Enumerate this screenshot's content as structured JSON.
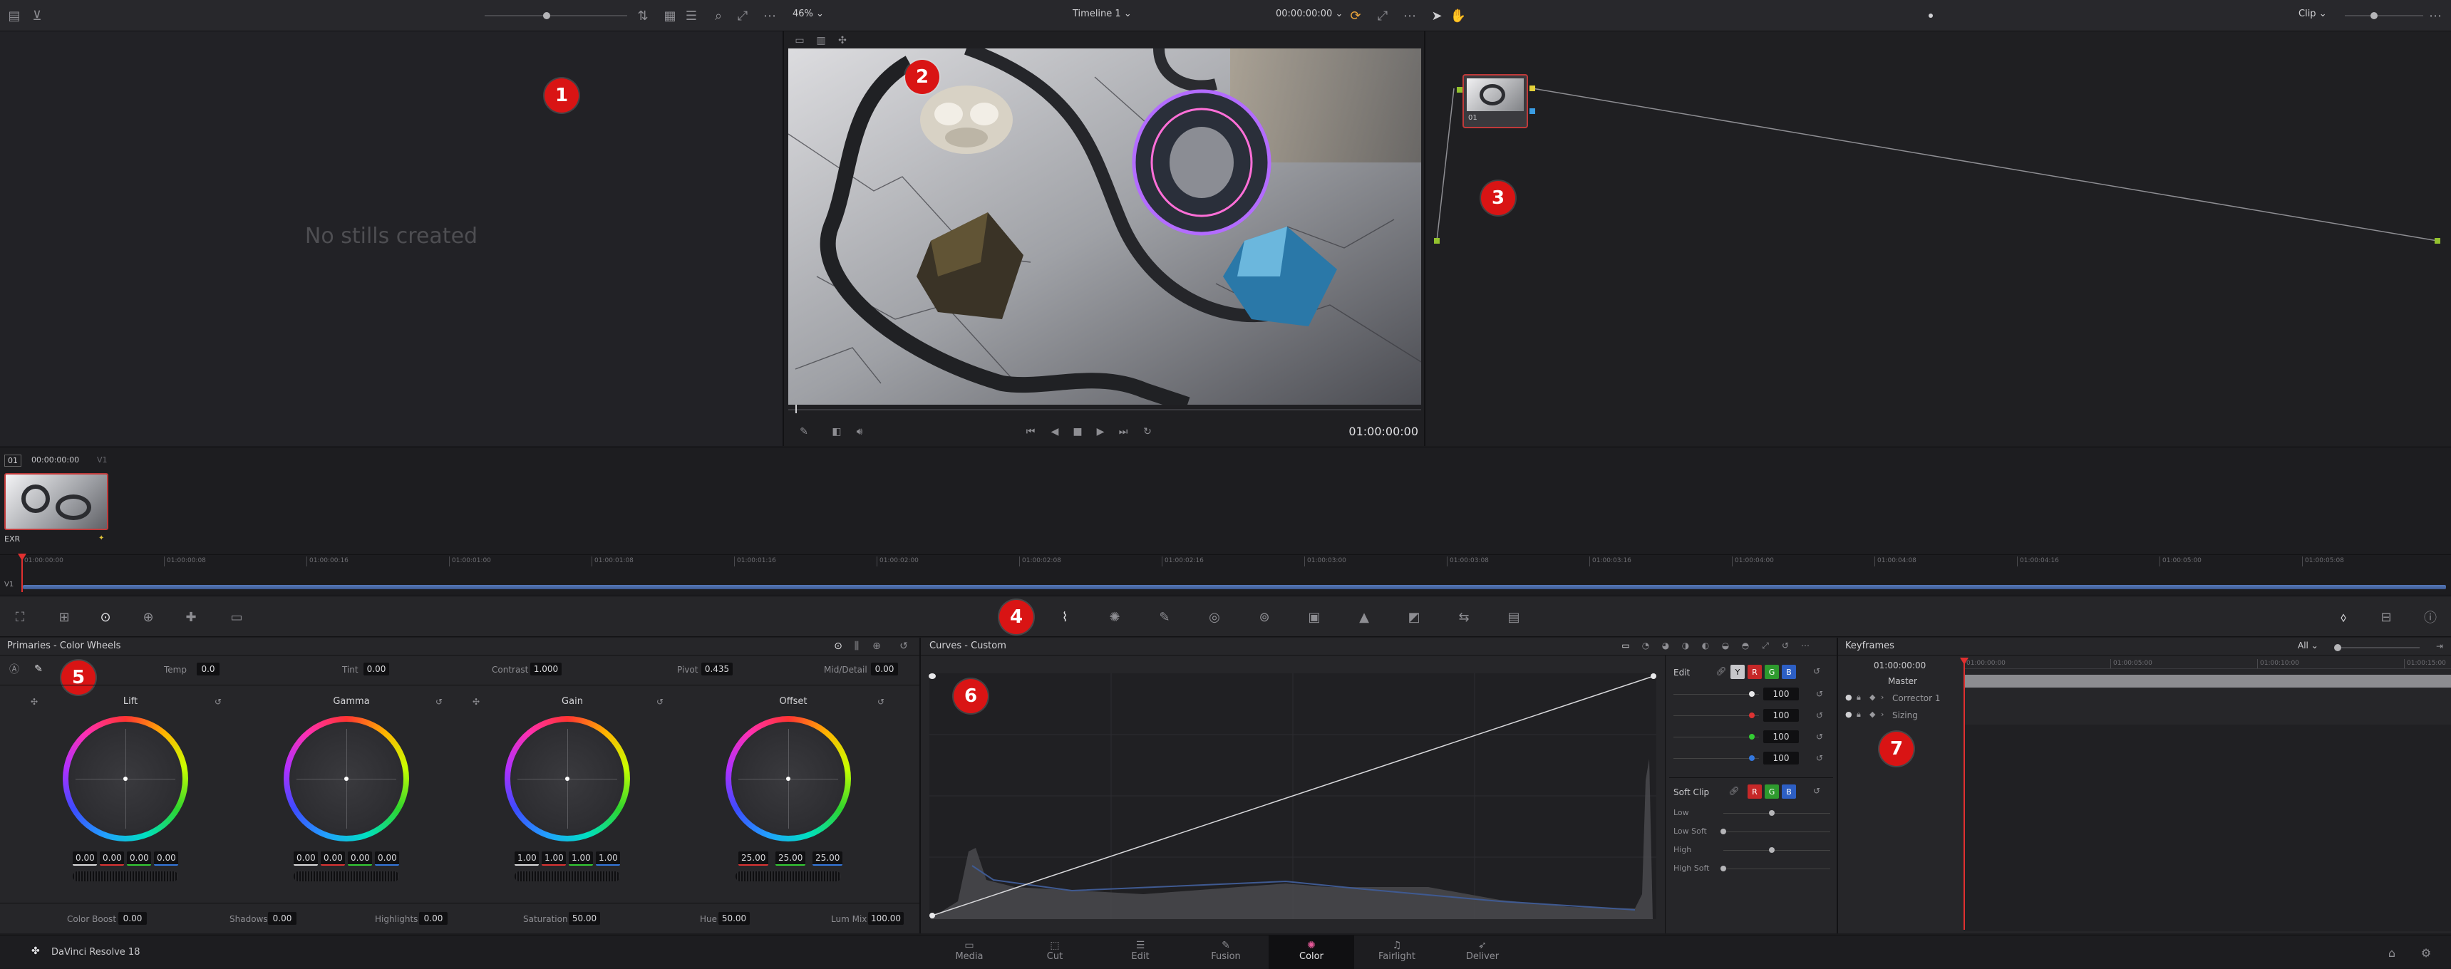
{
  "topbar": {
    "zoom": "46%",
    "timeline_name": "Timeline 1",
    "timecode": "00:00:00:00",
    "node_mode": "Clip"
  },
  "gallery": {
    "empty_text": "No stills created"
  },
  "viewer": {
    "timecode": "01:00:00:00"
  },
  "node": {
    "label": "01"
  },
  "clip_strip": {
    "clip_number": "01",
    "clip_timecode": "00:00:00:00",
    "track": "V1",
    "clip_codec": "EXR"
  },
  "mini_timeline": {
    "track": "V1",
    "ticks": [
      "01:00:00:00",
      "01:00:00:08",
      "01:00:00:16",
      "01:00:01:00",
      "01:00:01:08",
      "01:00:01:16",
      "01:00:02:00",
      "01:00:02:08",
      "01:00:02:16",
      "01:00:03:00",
      "01:00:03:08",
      "01:00:03:16",
      "01:00:04:00",
      "01:00:04:08",
      "01:00:04:16",
      "01:00:05:00",
      "01:00:05:08"
    ]
  },
  "primaries": {
    "title": "Primaries - Color Wheels",
    "temp_label": "Temp",
    "temp": "0.0",
    "tint_label": "Tint",
    "tint": "0.00",
    "contrast_label": "Contrast",
    "contrast": "1.000",
    "pivot_label": "Pivot",
    "pivot": "0.435",
    "mid_label": "Mid/Detail",
    "mid": "0.00",
    "wheels": [
      {
        "name": "Lift",
        "values": [
          "0.00",
          "0.00",
          "0.00",
          "0.00"
        ]
      },
      {
        "name": "Gamma",
        "values": [
          "0.00",
          "0.00",
          "0.00",
          "0.00"
        ]
      },
      {
        "name": "Gain",
        "values": [
          "1.00",
          "1.00",
          "1.00",
          "1.00"
        ]
      },
      {
        "name": "Offset",
        "values": [
          "25.00",
          "25.00",
          "25.00"
        ]
      }
    ],
    "bottom": {
      "color_boost_label": "Color Boost",
      "color_boost": "0.00",
      "shadows_label": "Shadows",
      "shadows": "0.00",
      "highlights_label": "Highlights",
      "highlights": "0.00",
      "saturation_label": "Saturation",
      "saturation": "50.00",
      "hue_label": "Hue",
      "hue": "50.00",
      "lum_mix_label": "Lum Mix",
      "lum_mix": "100.00"
    }
  },
  "curves": {
    "title": "Curves - Custom",
    "edit_label": "Edit",
    "channels": [
      "Y",
      "R",
      "G",
      "B"
    ],
    "intensity": [
      "100",
      "100",
      "100",
      "100"
    ],
    "soft_clip_label": "Soft Clip",
    "soft_clip_rows": [
      "Low",
      "Low Soft",
      "High",
      "High Soft"
    ]
  },
  "keyframes": {
    "title": "Keyframes",
    "filter": "All",
    "timecode": "01:00:00:00",
    "ruler": [
      "01:00:00:00",
      "01:00:05:00",
      "01:00:10:00",
      "01:00:15:00"
    ],
    "rows": [
      "Master",
      "Corrector 1",
      "Sizing"
    ]
  },
  "footer": {
    "app_name": "DaVinci Resolve 18",
    "tabs": [
      "Media",
      "Cut",
      "Edit",
      "Fusion",
      "Color",
      "Fairlight",
      "Deliver"
    ],
    "active_tab": "Color"
  },
  "callouts": [
    "1",
    "2",
    "3",
    "4",
    "5",
    "6",
    "7"
  ],
  "colors": {
    "accent": "#d91414",
    "active_tab_bg": "#101012",
    "playhead": "#e03030"
  }
}
